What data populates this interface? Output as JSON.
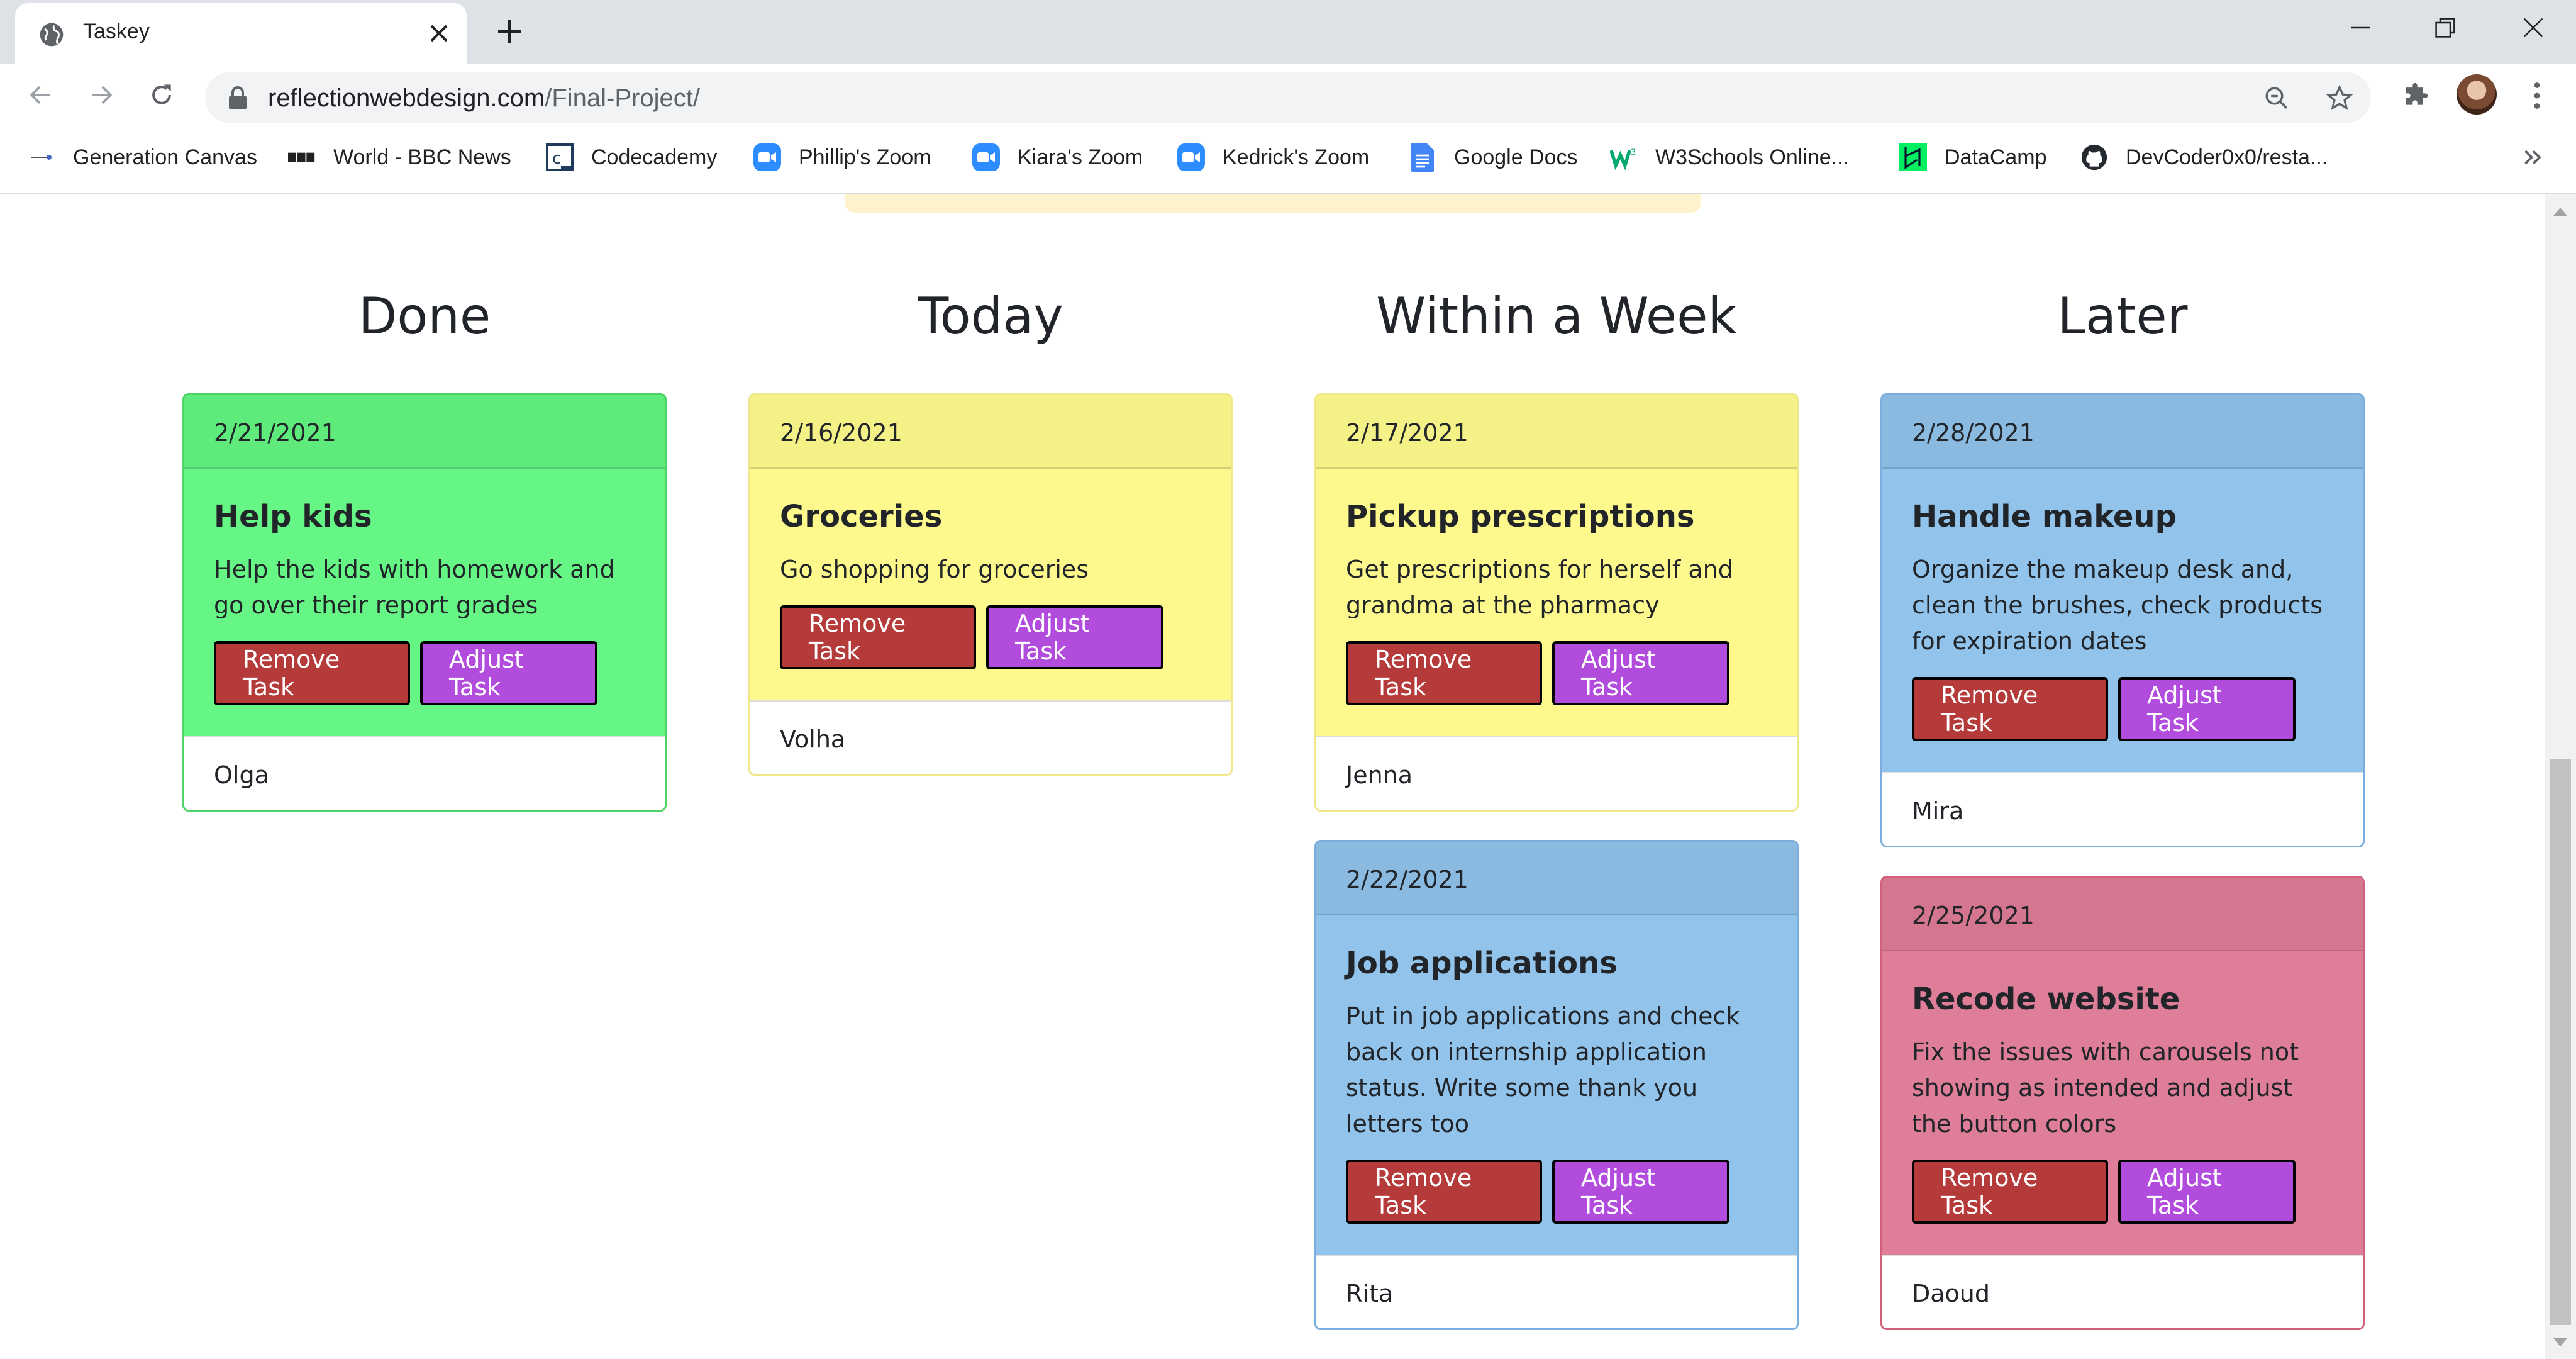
{
  "browser": {
    "tab_title": "Taskey",
    "url_host": "reflectionwebdesign.com",
    "url_path": "/Final-Project/",
    "bookmarks": [
      {
        "label": "Generation Canvas",
        "icon": "canvas-icon"
      },
      {
        "label": "World - BBC News",
        "icon": "bbc-icon"
      },
      {
        "label": "Codecademy",
        "icon": "codecademy-icon"
      },
      {
        "label": "Phillip's Zoom",
        "icon": "zoom-icon"
      },
      {
        "label": "Kiara's Zoom",
        "icon": "zoom-icon"
      },
      {
        "label": "Kedrick's Zoom",
        "icon": "zoom-icon"
      },
      {
        "label": "Google Docs",
        "icon": "google-docs-icon"
      },
      {
        "label": "W3Schools Online...",
        "icon": "w3schools-icon"
      },
      {
        "label": "DataCamp",
        "icon": "datacamp-icon"
      },
      {
        "label": "DevCoder0x0/resta...",
        "icon": "github-icon"
      }
    ]
  },
  "board": {
    "columns": [
      {
        "title": "Done",
        "cards": [
          {
            "date": "2/21/2021",
            "title": "Help kids",
            "text": "Help the kids with homework and go over their report grades",
            "owner": "Olga",
            "color": "green"
          }
        ]
      },
      {
        "title": "Today",
        "cards": [
          {
            "date": "2/16/2021",
            "title": "Groceries",
            "text": "Go shopping for groceries",
            "owner": "Volha",
            "color": "yellow"
          }
        ]
      },
      {
        "title": "Within a Week",
        "cards": [
          {
            "date": "2/17/2021",
            "title": "Pickup prescriptions",
            "text": "Get prescriptions for herself and grandma at the pharmacy",
            "owner": "Jenna",
            "color": "yellow"
          },
          {
            "date": "2/22/2021",
            "title": "Job applications",
            "text": "Put in job applications and check back on internship application status. Write some thank you letters too",
            "owner": "Rita",
            "color": "blue"
          }
        ]
      },
      {
        "title": "Later",
        "cards": [
          {
            "date": "2/28/2021",
            "title": "Handle makeup",
            "text": "Organize the makeup desk and, clean the brushes, check products for expiration dates",
            "owner": "Mira",
            "color": "blue"
          },
          {
            "date": "2/25/2021",
            "title": "Recode website",
            "text": "Fix the issues with carousels not showing as intended and adjust the button colors",
            "owner": "Daoud",
            "color": "pink"
          }
        ]
      }
    ],
    "buttons": {
      "remove": "Remove Task",
      "adjust": "Adjust Task"
    }
  },
  "colors": {
    "green": {
      "header": "#5fea7c",
      "body": "#66f685",
      "border": "#4cd466"
    },
    "yellow": {
      "header": "#f4f186",
      "body": "#fdf98d",
      "border": "#f0e68c"
    },
    "blue": {
      "header": "#8abae0",
      "body": "#92c3ea",
      "border": "#7aaede"
    },
    "pink": {
      "header": "#d47690",
      "body": "#de7e99",
      "border": "#d0607c"
    },
    "remove_button": "#b53a3a",
    "adjust_button": "#b14cdc"
  }
}
